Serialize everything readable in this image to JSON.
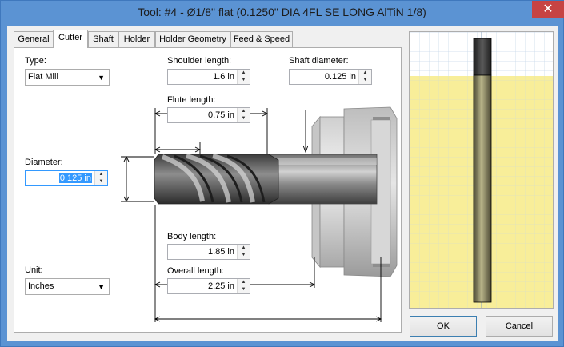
{
  "window": {
    "title": "Tool: #4 - Ø1/8\" flat (0.1250\" DIA 4FL SE LONG AlTiN 1/8)"
  },
  "tabs": [
    {
      "label": "General"
    },
    {
      "label": "Cutter"
    },
    {
      "label": "Shaft"
    },
    {
      "label": "Holder"
    },
    {
      "label": "Holder Geometry"
    },
    {
      "label": "Feed & Speed"
    }
  ],
  "cutter": {
    "type_label": "Type:",
    "type_value": "Flat Mill",
    "diameter_label": "Diameter:",
    "diameter_value": "0.125 in",
    "unit_label": "Unit:",
    "unit_value": "Inches",
    "shoulder_label": "Shoulder length:",
    "shoulder_value": "1.6 in",
    "shaft_diameter_label": "Shaft diameter:",
    "shaft_diameter_value": "0.125 in",
    "flute_label": "Flute length:",
    "flute_value": "0.75 in",
    "body_label": "Body length:",
    "body_value": "1.85 in",
    "overall_label": "Overall length:",
    "overall_value": "2.25 in"
  },
  "buttons": {
    "ok": "OK",
    "cancel": "Cancel"
  },
  "icons": {
    "close": "close-icon",
    "dropdown": "chevron-down-icon",
    "spin": "spin-arrows-icon"
  },
  "colors": {
    "title_bar": "#5b93d3",
    "selection": "#3399ff",
    "preview_stock": "#f7ec8e",
    "close": "#c74343"
  }
}
